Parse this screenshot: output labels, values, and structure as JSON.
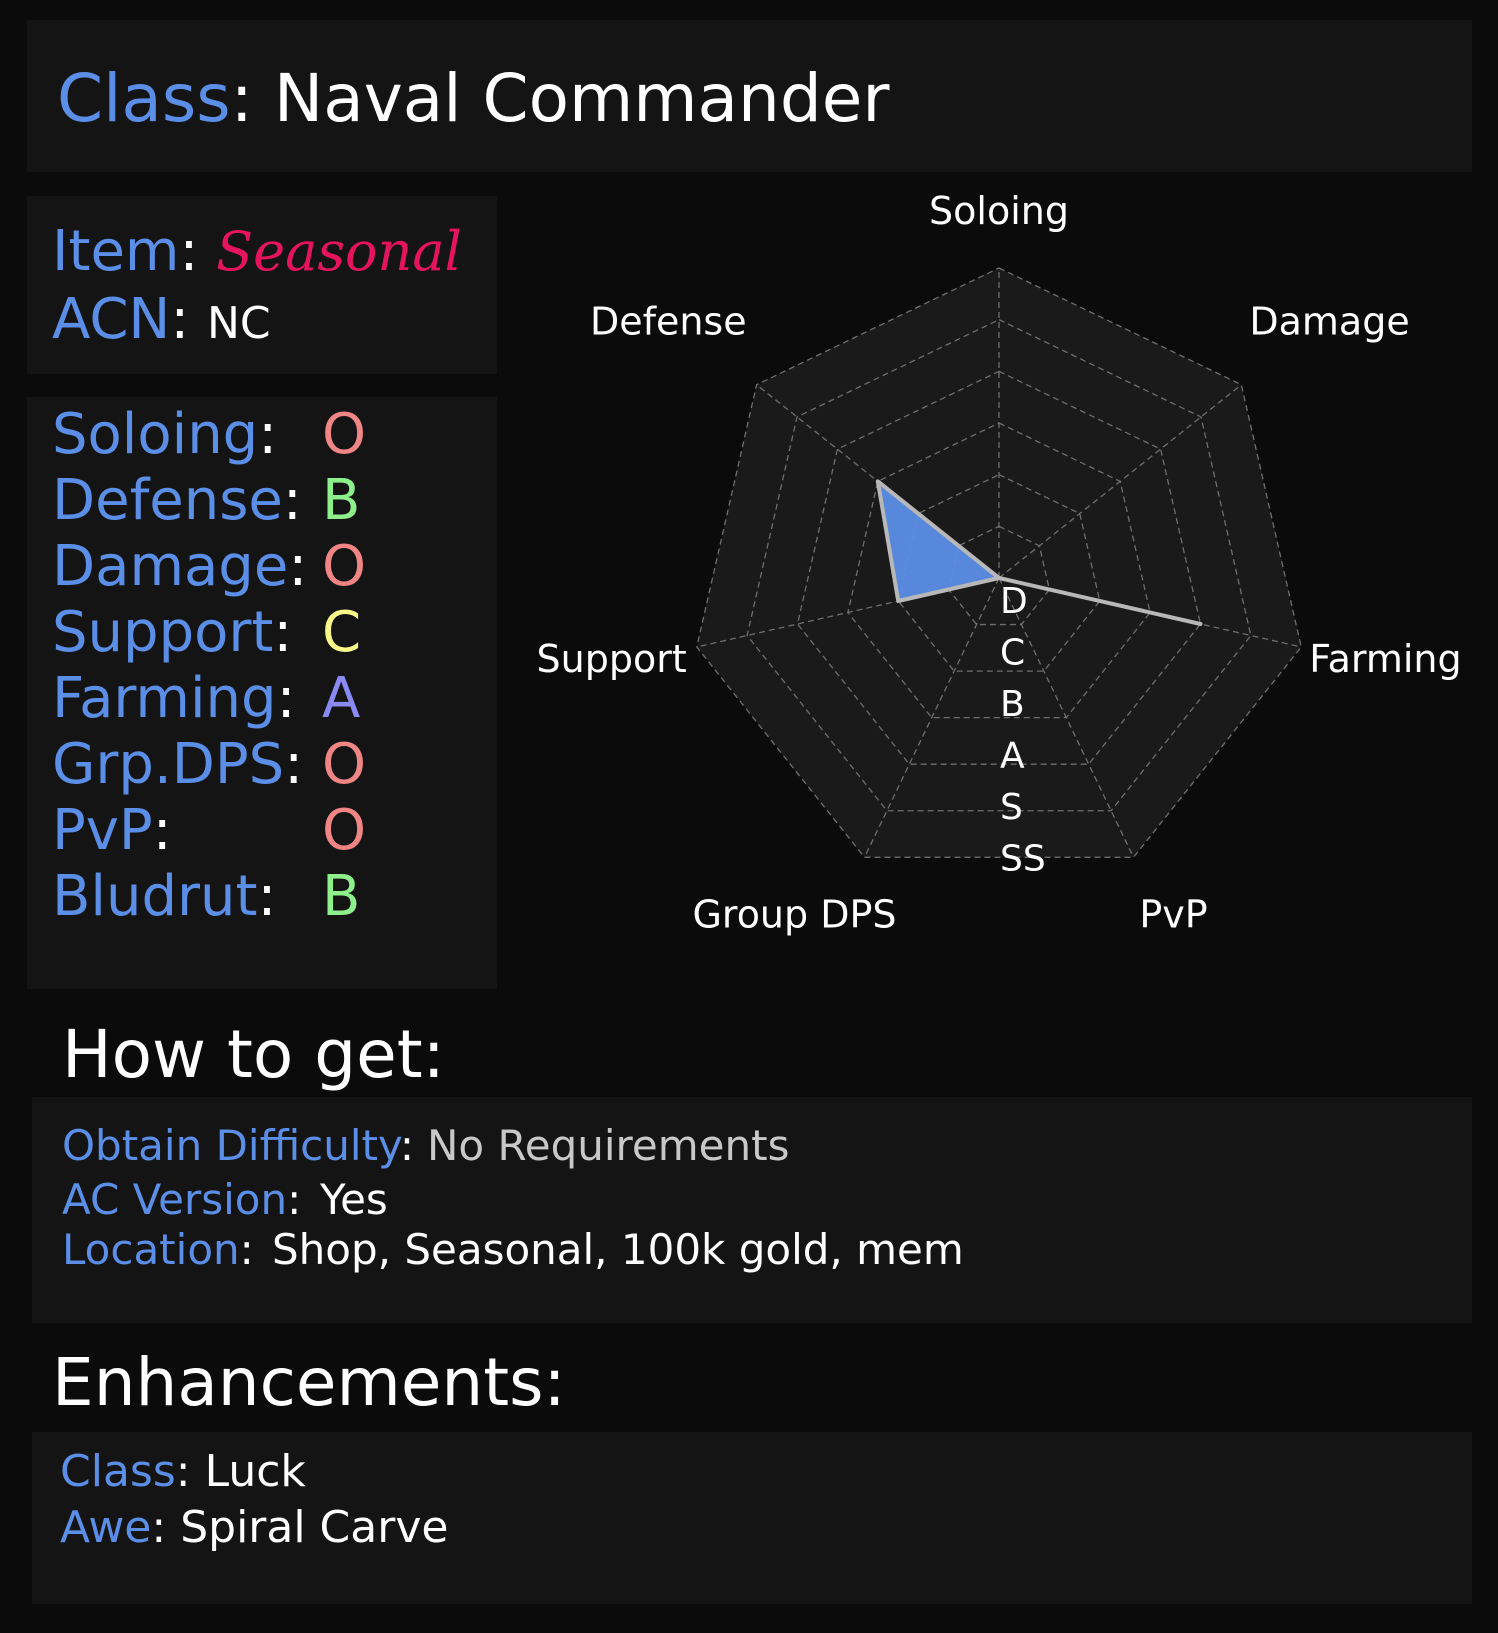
{
  "header": {
    "class_label": "Class",
    "colon": ":",
    "class_name": "Naval Commander"
  },
  "item_info": {
    "item_label": "Item",
    "item_value": "Seasonal",
    "acn_label": "ACN",
    "acn_value": "NC"
  },
  "rankings": [
    {
      "label": "Soloing",
      "grade": "O",
      "color": "#f08585"
    },
    {
      "label": "Defense",
      "grade": "B",
      "color": "#8ef08a"
    },
    {
      "label": "Damage",
      "grade": "O",
      "color": "#f08585"
    },
    {
      "label": "Support",
      "grade": "C",
      "color": "#f7f78a"
    },
    {
      "label": "Farming",
      "grade": "A",
      "color": "#8a8af5"
    },
    {
      "label": "Grp.DPS",
      "grade": "O",
      "color": "#f08585"
    },
    {
      "label": "PvP",
      "grade": "O",
      "color": "#f08585"
    },
    {
      "label": "Bludrut",
      "grade": "B",
      "color": "#8ef08a"
    }
  ],
  "chart_data": {
    "type": "radar",
    "axes": [
      "Soloing",
      "Damage",
      "Farming",
      "PvP",
      "Group DPS",
      "Support",
      "Defense"
    ],
    "scale_labels": [
      "D",
      "C",
      "B",
      "A",
      "S",
      "SS"
    ],
    "max": 6,
    "values": [
      0,
      0,
      4,
      0,
      0,
      2,
      3
    ],
    "fill_color": "#5b8ee6",
    "line_color": "#b8b8b8",
    "grid": true
  },
  "how_to_get": {
    "heading": "How to get:",
    "obtain_label": "Obtain Difficulty",
    "obtain_value": "No Requirements",
    "ac_label": "AC Version",
    "ac_value": "Yes",
    "location_label": "Location",
    "location_value": "Shop, Seasonal, 100k gold, mem"
  },
  "enhancements": {
    "heading": "Enhancements:",
    "class_label": "Class",
    "class_value": "Luck",
    "awe_label": "Awe",
    "awe_value": "Spiral Carve"
  },
  "colors": {
    "label_blue": "#5b8ee6",
    "item_pink": "#e6145e",
    "panel_bg": "#141414",
    "page_bg": "#0b0b0b"
  }
}
